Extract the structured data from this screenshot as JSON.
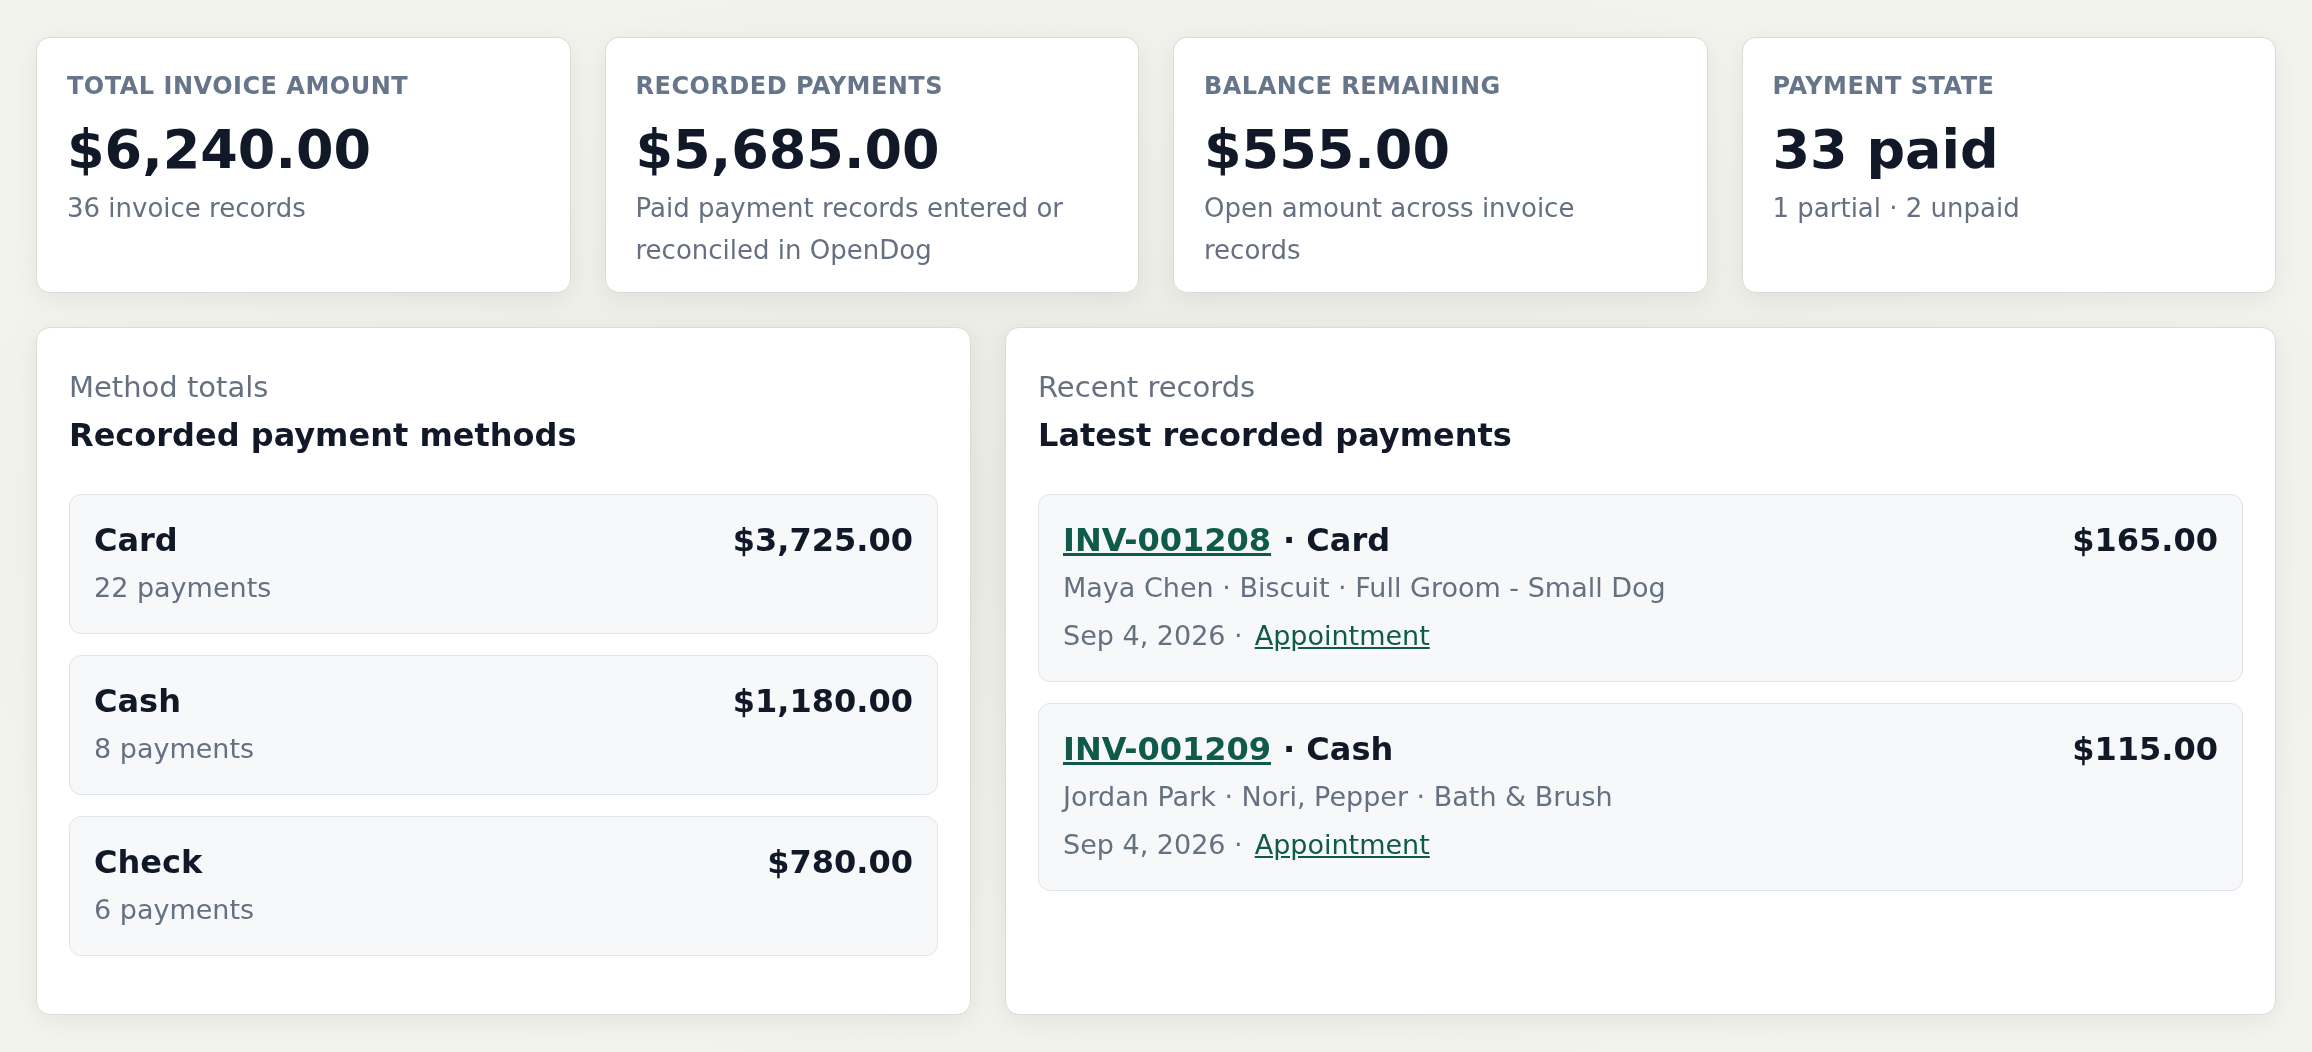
{
  "stats": [
    {
      "label": "TOTAL INVOICE AMOUNT",
      "value": "$6,240.00",
      "note": "36 invoice records"
    },
    {
      "label": "RECORDED PAYMENTS",
      "value": "$5,685.00",
      "note": "Paid payment records entered or reconciled in OpenDog"
    },
    {
      "label": "BALANCE REMAINING",
      "value": "$555.00",
      "note": "Open amount across invoice records"
    },
    {
      "label": "PAYMENT STATE",
      "value": "33 paid",
      "note": "1 partial · 2 unpaid"
    }
  ],
  "methods": {
    "eyebrow": "Method totals",
    "title": "Recorded payment methods",
    "items": [
      {
        "name": "Card",
        "amount": "$3,725.00",
        "count": "22 payments"
      },
      {
        "name": "Cash",
        "amount": "$1,180.00",
        "count": "8 payments"
      },
      {
        "name": "Check",
        "amount": "$780.00",
        "count": "6 payments"
      }
    ]
  },
  "recent": {
    "eyebrow": "Recent records",
    "title": "Latest recorded payments",
    "items": [
      {
        "invoice": "INV-001208",
        "method": "· Card",
        "amount": "$165.00",
        "details": "Maya Chen · Biscuit · Full Groom - Small Dog",
        "date": "Sep 4, 2026 ·",
        "link": "Appointment"
      },
      {
        "invoice": "INV-001209",
        "method": "· Cash",
        "amount": "$115.00",
        "details": "Jordan Park · Nori, Pepper · Bath & Brush",
        "date": "Sep 4, 2026 ·",
        "link": "Appointment"
      }
    ]
  }
}
